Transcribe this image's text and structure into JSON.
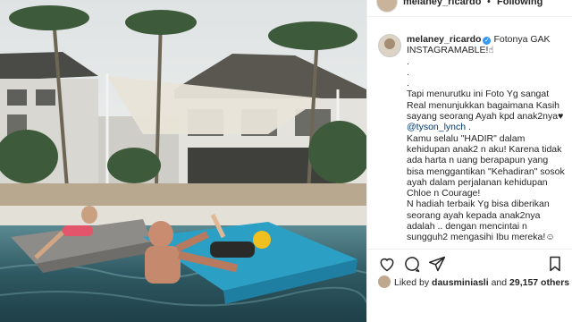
{
  "header": {
    "username": "melaney_ricardo",
    "separator": "•",
    "follow_label": "Following"
  },
  "post": {
    "username": "melaney_ricardo",
    "verified_icon": "verified-badge-icon",
    "caption_lines": [
      "Fotonya GAK INSTAGRAMABLE!☝",
      ".",
      ".",
      ".",
      "Tapi menurutku ini Foto Yg sangat Real menunjukkan bagaimana Kasih sayang seorang Ayah kpd anak2nya♥",
      "@tyson_lynch .",
      "Kamu selalu \"HADIR\" dalam kehidupan anak2 n aku! Karena tidak ada harta n uang berapapun yang bisa menggantikan \"Kehadiran\" sosok ayah dalam perjalanan kehidupan Chloe n Courage!",
      "N hadiah terbaik Yg bisa diberikan seorang ayah kepada anak2nya adalah .. dengan mencintai n sungguh2 mengasihi Ibu mereka!☺"
    ]
  },
  "actions": {
    "like_icon": "heart-icon",
    "comment_icon": "comment-icon",
    "share_icon": "share-icon",
    "save_icon": "bookmark-icon"
  },
  "likes": {
    "prefix": "Liked by",
    "user": "dausminiasli",
    "conjunction": "and",
    "count": "29,157 others"
  },
  "colors": {
    "accent": "#3897f0",
    "text": "#262626",
    "mention": "#00376b",
    "divider": "#efefef"
  }
}
